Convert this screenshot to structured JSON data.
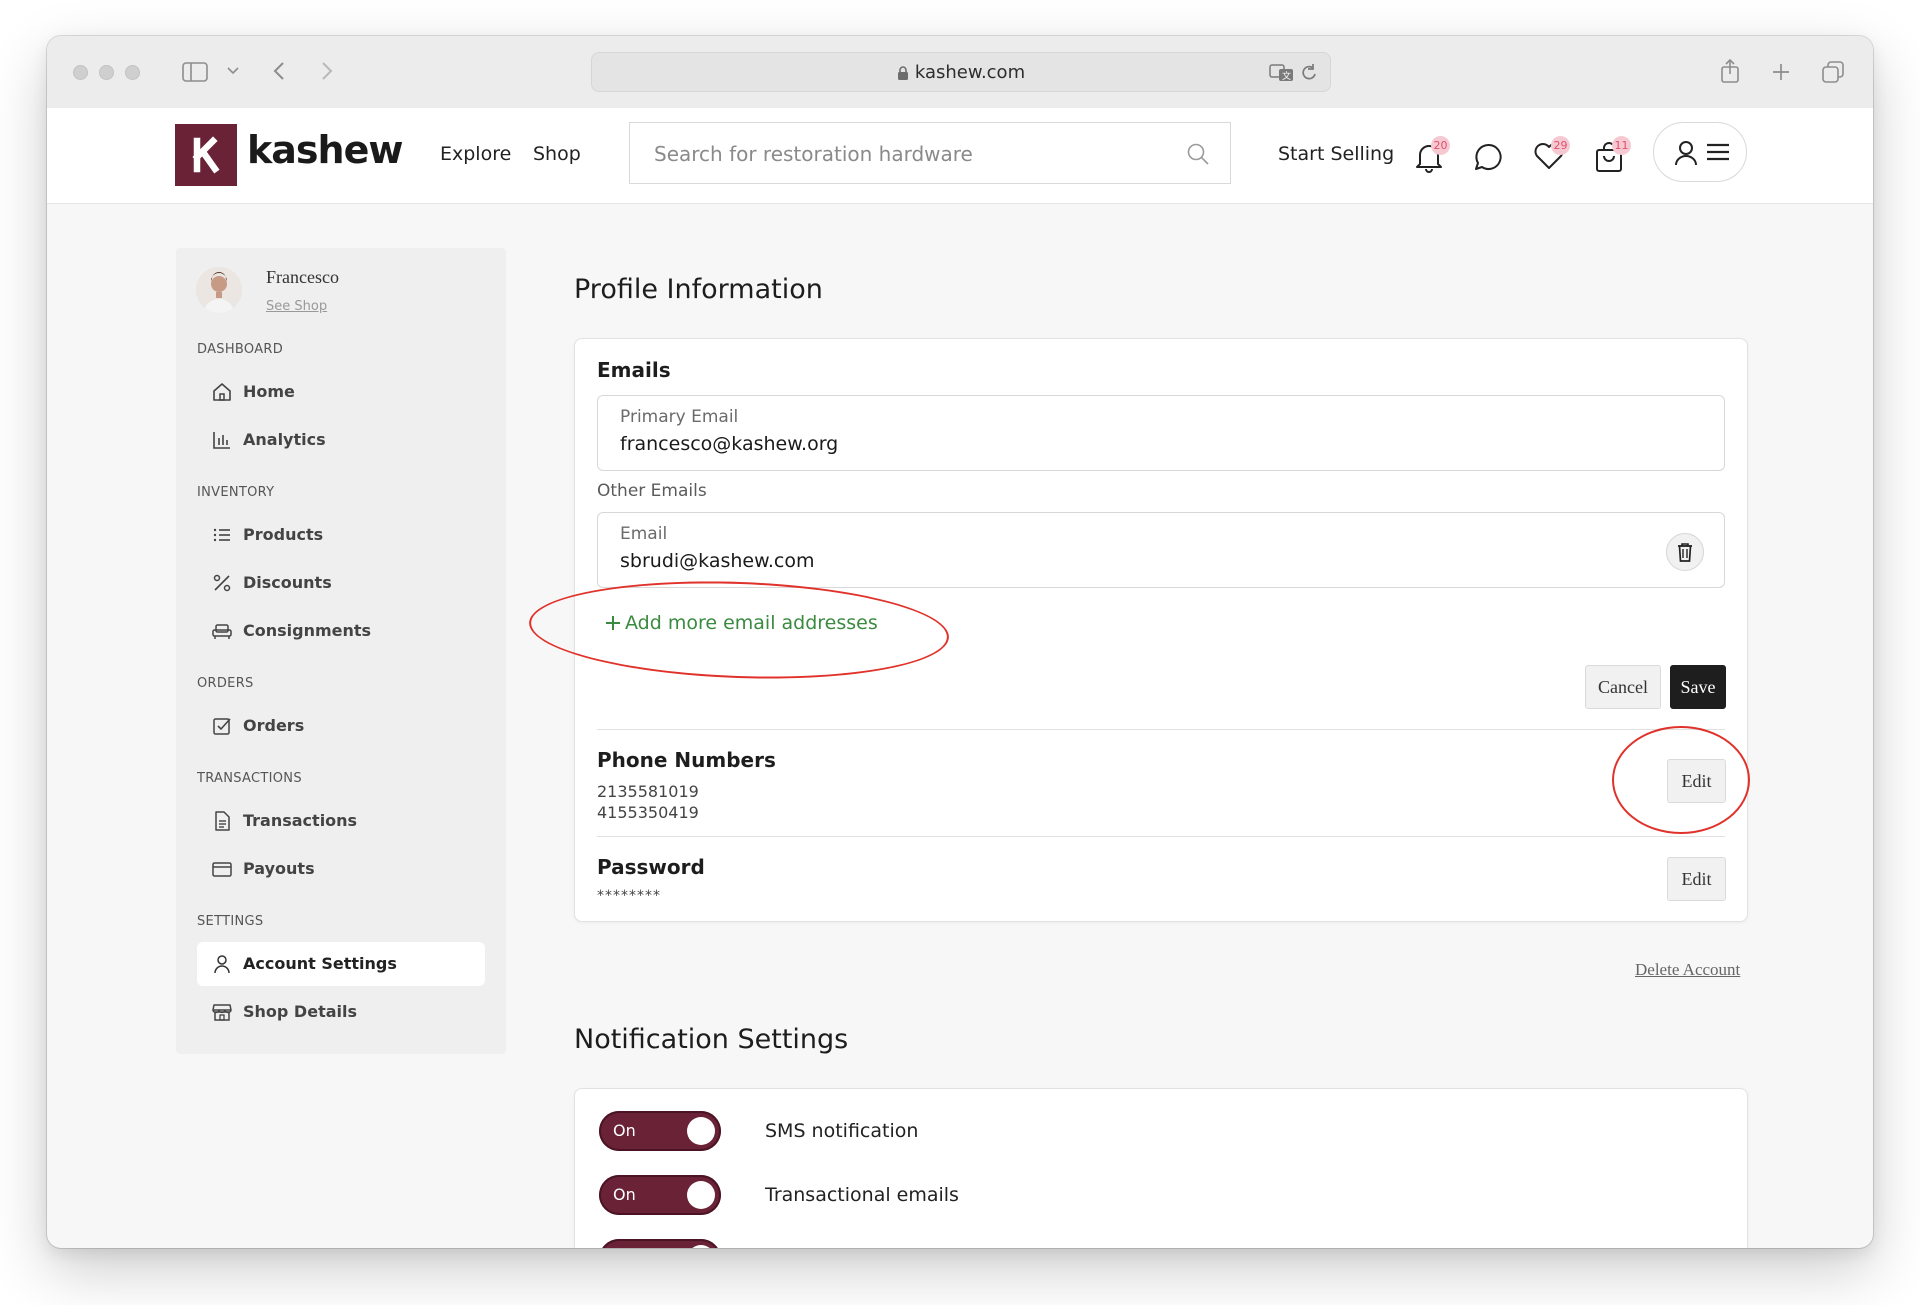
{
  "browser": {
    "url": "kashew.com"
  },
  "header": {
    "logo_text": "kashew",
    "nav": [
      "Explore",
      "Shop"
    ],
    "search_placeholder": "Search for restoration hardware",
    "start_selling": "Start Selling",
    "badges": {
      "notifications": "20",
      "favorites": "29",
      "cart": "11"
    }
  },
  "sidebar": {
    "user_name": "Francesco",
    "see_shop": "See Shop",
    "sections": {
      "dashboard": "DASHBOARD",
      "inventory": "INVENTORY",
      "orders": "ORDERS",
      "transactions": "TRANSACTIONS",
      "settings": "SETTINGS"
    },
    "items": {
      "home": "Home",
      "analytics": "Analytics",
      "products": "Products",
      "discounts": "Discounts",
      "consignments": "Consignments",
      "orders": "Orders",
      "transactions": "Transactions",
      "payouts": "Payouts",
      "account_settings": "Account Settings",
      "shop_details": "Shop Details"
    }
  },
  "profile": {
    "title": "Profile Information",
    "emails": {
      "title": "Emails",
      "primary_label": "Primary Email",
      "primary_value": "francesco@kashew.org",
      "other_label": "Other Emails",
      "other_field_label": "Email",
      "other_value": "sbrudi@kashew.com",
      "add_more": "Add more email addresses",
      "cancel": "Cancel",
      "save": "Save"
    },
    "phones": {
      "title": "Phone Numbers",
      "numbers": [
        "2135581019",
        "4155350419"
      ],
      "edit": "Edit"
    },
    "password": {
      "title": "Password",
      "value": "********",
      "edit": "Edit"
    },
    "delete_account": "Delete Account"
  },
  "notifications": {
    "title": "Notification Settings",
    "items": [
      {
        "label": "SMS notification",
        "state": "On"
      },
      {
        "label": "Transactional emails",
        "state": "On"
      }
    ]
  },
  "colors": {
    "brand": "#6a2336",
    "add_link": "#3a8a3f",
    "annotation": "#e0322a"
  }
}
